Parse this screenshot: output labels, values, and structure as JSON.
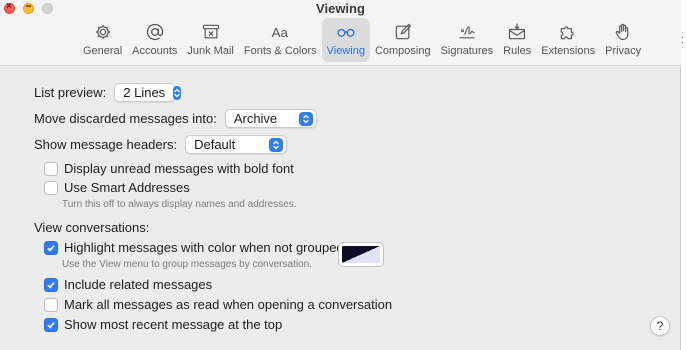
{
  "window": {
    "title": "Viewing"
  },
  "colors": {
    "accent": "#2f7cf6",
    "active_tab_text": "#2a6edb",
    "close": "#fe5f57",
    "minimize": "#febc2e"
  },
  "tabs": [
    {
      "label": "General",
      "icon": "gear-icon"
    },
    {
      "label": "Accounts",
      "icon": "at-sign-icon"
    },
    {
      "label": "Junk Mail",
      "icon": "junk-tray-icon"
    },
    {
      "label": "Fonts & Colors",
      "icon": "font-aa-icon"
    },
    {
      "label": "Viewing",
      "icon": "glasses-icon",
      "active": true
    },
    {
      "label": "Composing",
      "icon": "compose-icon"
    },
    {
      "label": "Signatures",
      "icon": "signature-icon"
    },
    {
      "label": "Rules",
      "icon": "rules-envelope-icon"
    },
    {
      "label": "Extensions",
      "icon": "puzzle-icon"
    },
    {
      "label": "Privacy",
      "icon": "hand-icon"
    }
  ],
  "list_preview": {
    "label": "List preview:",
    "value": "2 Lines"
  },
  "discarded": {
    "label": "Move discarded messages into:",
    "value": "Archive"
  },
  "headers": {
    "label": "Show message headers:",
    "value": "Default"
  },
  "options": {
    "bold_unread": {
      "label": "Display unread messages with bold font",
      "checked": false
    },
    "smart_addresses": {
      "label": "Use Smart Addresses",
      "checked": false,
      "hint": "Turn this off to always display names and addresses."
    }
  },
  "conversations": {
    "heading": "View conversations:",
    "highlight": {
      "label": "Highlight messages with color when not grouped",
      "checked": true,
      "hint": "Use the View menu to group messages by conversation."
    },
    "include_related": {
      "label": "Include related messages",
      "checked": true
    },
    "mark_read": {
      "label": "Mark all messages as read when opening a conversation",
      "checked": false
    },
    "recent_top": {
      "label": "Show most recent message at the top",
      "checked": true
    }
  },
  "help": {
    "label": "?"
  },
  "edge_mark": ":"
}
